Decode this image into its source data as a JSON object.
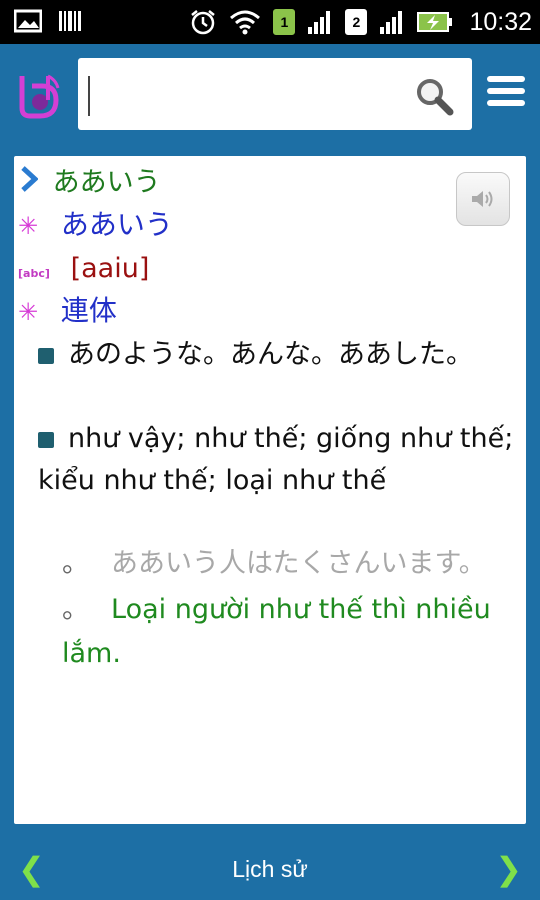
{
  "status_bar": {
    "time": "10:32",
    "sim1": "1",
    "sim2": "2"
  },
  "search": {
    "value": "",
    "placeholder": ""
  },
  "entry": {
    "headword": "ああいう",
    "kana": "ああいう",
    "romaji": "[aaiu]",
    "part_of_speech": "連体",
    "meanings": [
      "あのような。あんな。ああした。",
      "như vậy; như thế; giống như thế; kiểu như thế; loại như thế"
    ],
    "examples": [
      "ああいう人はたくさんいます。",
      "Loại người như thế thì nhiều lắm."
    ],
    "example_marker": "。"
  },
  "footer": {
    "history_label": "Lịch sử",
    "prev_label": "❮",
    "next_label": "❯"
  },
  "colors": {
    "app_blue": "#1d6fa5",
    "headword_green": "#1f7a1f",
    "kana_blue": "#2230c8",
    "romaji_red": "#9a1010",
    "marker_magenta": "#d63ad6",
    "nav_green": "#7fe04a"
  },
  "icons": {
    "logo": "app-logo-icon",
    "search": "magnifier-icon",
    "menu": "hamburger-menu-icon",
    "speaker": "speaker-icon",
    "expand": "chevron-right-icon"
  }
}
